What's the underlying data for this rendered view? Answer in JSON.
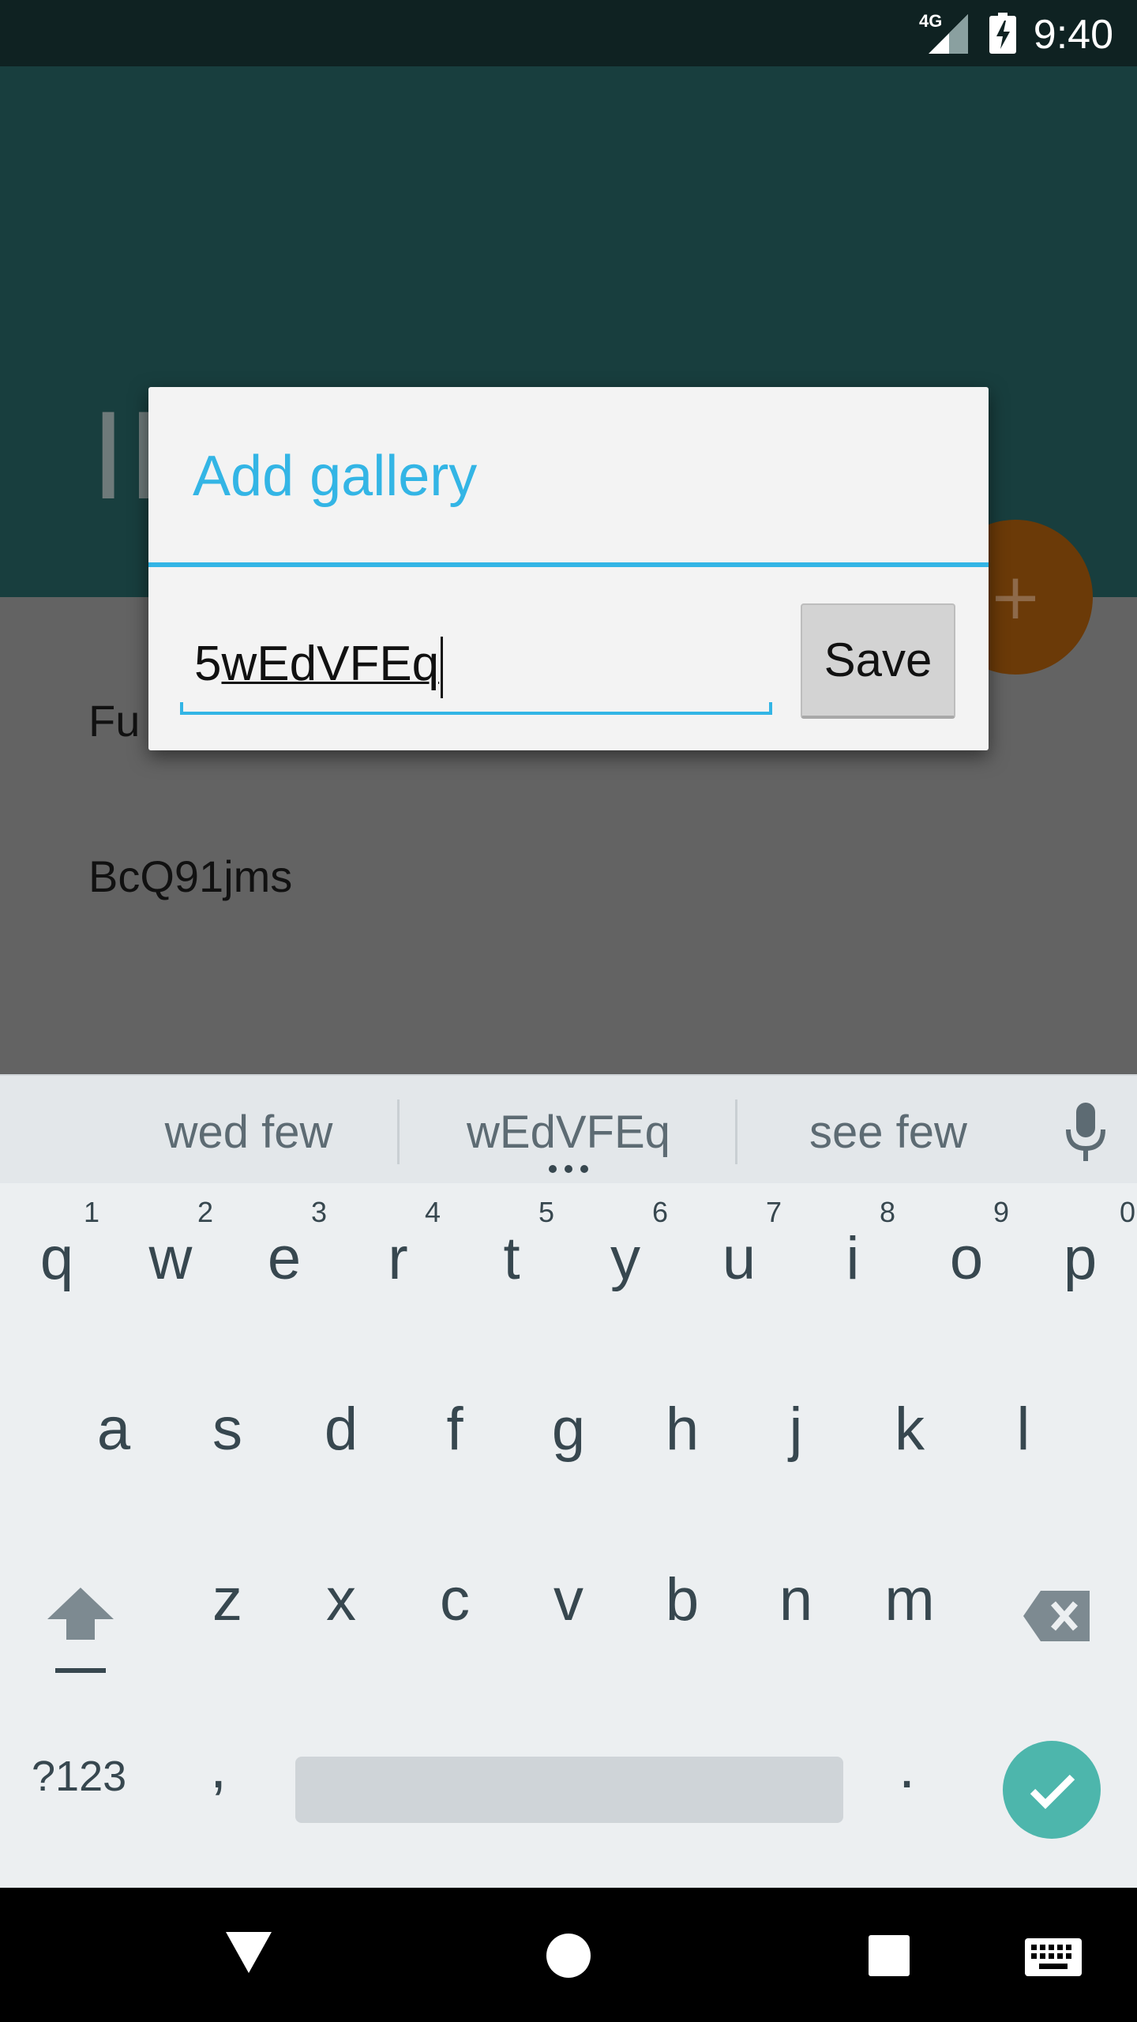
{
  "status_bar": {
    "time": "9:40",
    "network": "4G",
    "icons": [
      "signal-icon",
      "battery-charging-icon"
    ]
  },
  "background_app": {
    "title_partial": "IM",
    "list_items": [
      "Fu",
      "BcQ91jms"
    ],
    "fab_icon": "plus-icon"
  },
  "dialog": {
    "title": "Add gallery",
    "input_value_prefix": "5",
    "input_value_composing": "wEdVFEq",
    "save_label": "Save",
    "accent_color": "#33b5e5"
  },
  "keyboard": {
    "suggestions": [
      "wed few",
      "wEdVFEq",
      "see few"
    ],
    "row1": [
      {
        "key": "q",
        "hint": "1"
      },
      {
        "key": "w",
        "hint": "2"
      },
      {
        "key": "e",
        "hint": "3"
      },
      {
        "key": "r",
        "hint": "4"
      },
      {
        "key": "t",
        "hint": "5"
      },
      {
        "key": "y",
        "hint": "6"
      },
      {
        "key": "u",
        "hint": "7"
      },
      {
        "key": "i",
        "hint": "8"
      },
      {
        "key": "o",
        "hint": "9"
      },
      {
        "key": "p",
        "hint": "0"
      }
    ],
    "row2": [
      "a",
      "s",
      "d",
      "f",
      "g",
      "h",
      "j",
      "k",
      "l"
    ],
    "row3": [
      "z",
      "x",
      "c",
      "v",
      "b",
      "n",
      "m"
    ],
    "symbols_label": "?123",
    "comma": ",",
    "period": ".",
    "enter_icon": "check-icon",
    "enter_color": "#4db6ac"
  },
  "nav_bar": {
    "icons": [
      "back-icon",
      "home-icon",
      "recents-icon",
      "keyboard-icon"
    ]
  }
}
